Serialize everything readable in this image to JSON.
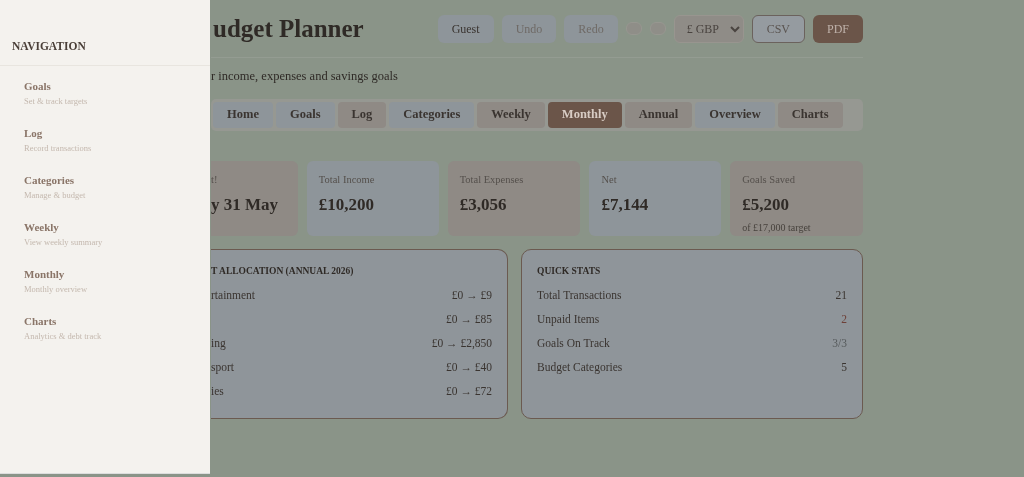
{
  "header": {
    "title": "udget Planner",
    "subtitle": "r income, expenses and savings goals",
    "buttons": [
      {
        "label": "Guest",
        "kind": "plain"
      },
      {
        "label": "Undo",
        "kind": "faded"
      },
      {
        "label": "Redo",
        "kind": "faded"
      },
      {
        "kind": "pill"
      },
      {
        "kind": "pill"
      }
    ],
    "currency": {
      "value": "£ GBP"
    },
    "exports": [
      {
        "label": "CSV",
        "kind": "outline"
      },
      {
        "label": "PDF",
        "kind": "solid"
      }
    ]
  },
  "tabs": [
    {
      "label": "Home",
      "selected": false,
      "color": "#8e959a"
    },
    {
      "label": "Goals",
      "selected": false,
      "color": "#8e959a"
    },
    {
      "label": "Log",
      "selected": false,
      "color": "#8f8a85"
    },
    {
      "label": "Categories",
      "selected": false,
      "color": "#8e959a"
    },
    {
      "label": "Weekly",
      "selected": false,
      "color": "#8f8a85"
    },
    {
      "label": "Monthly",
      "selected": true,
      "color": "#6b5549"
    },
    {
      "label": "Annual",
      "selected": false,
      "color": "#8f8a85"
    },
    {
      "label": "Overview",
      "selected": false,
      "color": "#8e959a"
    },
    {
      "label": "Charts",
      "selected": false,
      "color": "#8f8a85"
    }
  ],
  "cards": [
    {
      "label": "t!",
      "value": "y 31 May",
      "color": "#8f8a85"
    },
    {
      "label": "Total Income",
      "value": "£10,200",
      "color": "#8e959a"
    },
    {
      "label": "Total Expenses",
      "value": "£3,056",
      "color": "#8f8a85"
    },
    {
      "label": "Net",
      "value": "£7,144",
      "color": "#8e959a"
    },
    {
      "label": "Goals Saved",
      "value": "£5,200",
      "note": "of £17,000 target",
      "color": "#8f8a85"
    }
  ],
  "allocation": {
    "title": "T ALLOCATION (ANNUAL 2026)",
    "rows": [
      {
        "label": "rtainment",
        "range": "£0 → £9"
      },
      {
        "range": "£0 → £85"
      },
      {
        "label": "ing",
        "range": "£0 → £2,850"
      },
      {
        "label": "sport",
        "range": "£0 → £40"
      },
      {
        "label": "ies",
        "range": "£0 → £72"
      }
    ]
  },
  "quick_stats": {
    "title": "QUICK STATS",
    "rows": [
      {
        "label": "Total Transactions",
        "value": "21",
        "color": "#3a3430"
      },
      {
        "label": "Unpaid Items",
        "value": "2",
        "color": "#6e4038"
      },
      {
        "label": "Goals On Track",
        "value": "3/3",
        "color": "#55595a"
      },
      {
        "label": "Budget Categories",
        "value": "5",
        "color": "#3a3430"
      }
    ]
  },
  "drawer": {
    "title": "NAVIGATION",
    "items": [
      {
        "label": "Goals",
        "description": "Set & track targets"
      },
      {
        "label": "Log",
        "description": "Record transactions"
      },
      {
        "label": "Categories",
        "description": "Manage & budget"
      },
      {
        "label": "Weekly",
        "description": "View weekly summary"
      },
      {
        "label": "Monthly",
        "description": "Monthly overview"
      },
      {
        "label": "Charts",
        "description": "Analytics & debt track"
      }
    ]
  }
}
